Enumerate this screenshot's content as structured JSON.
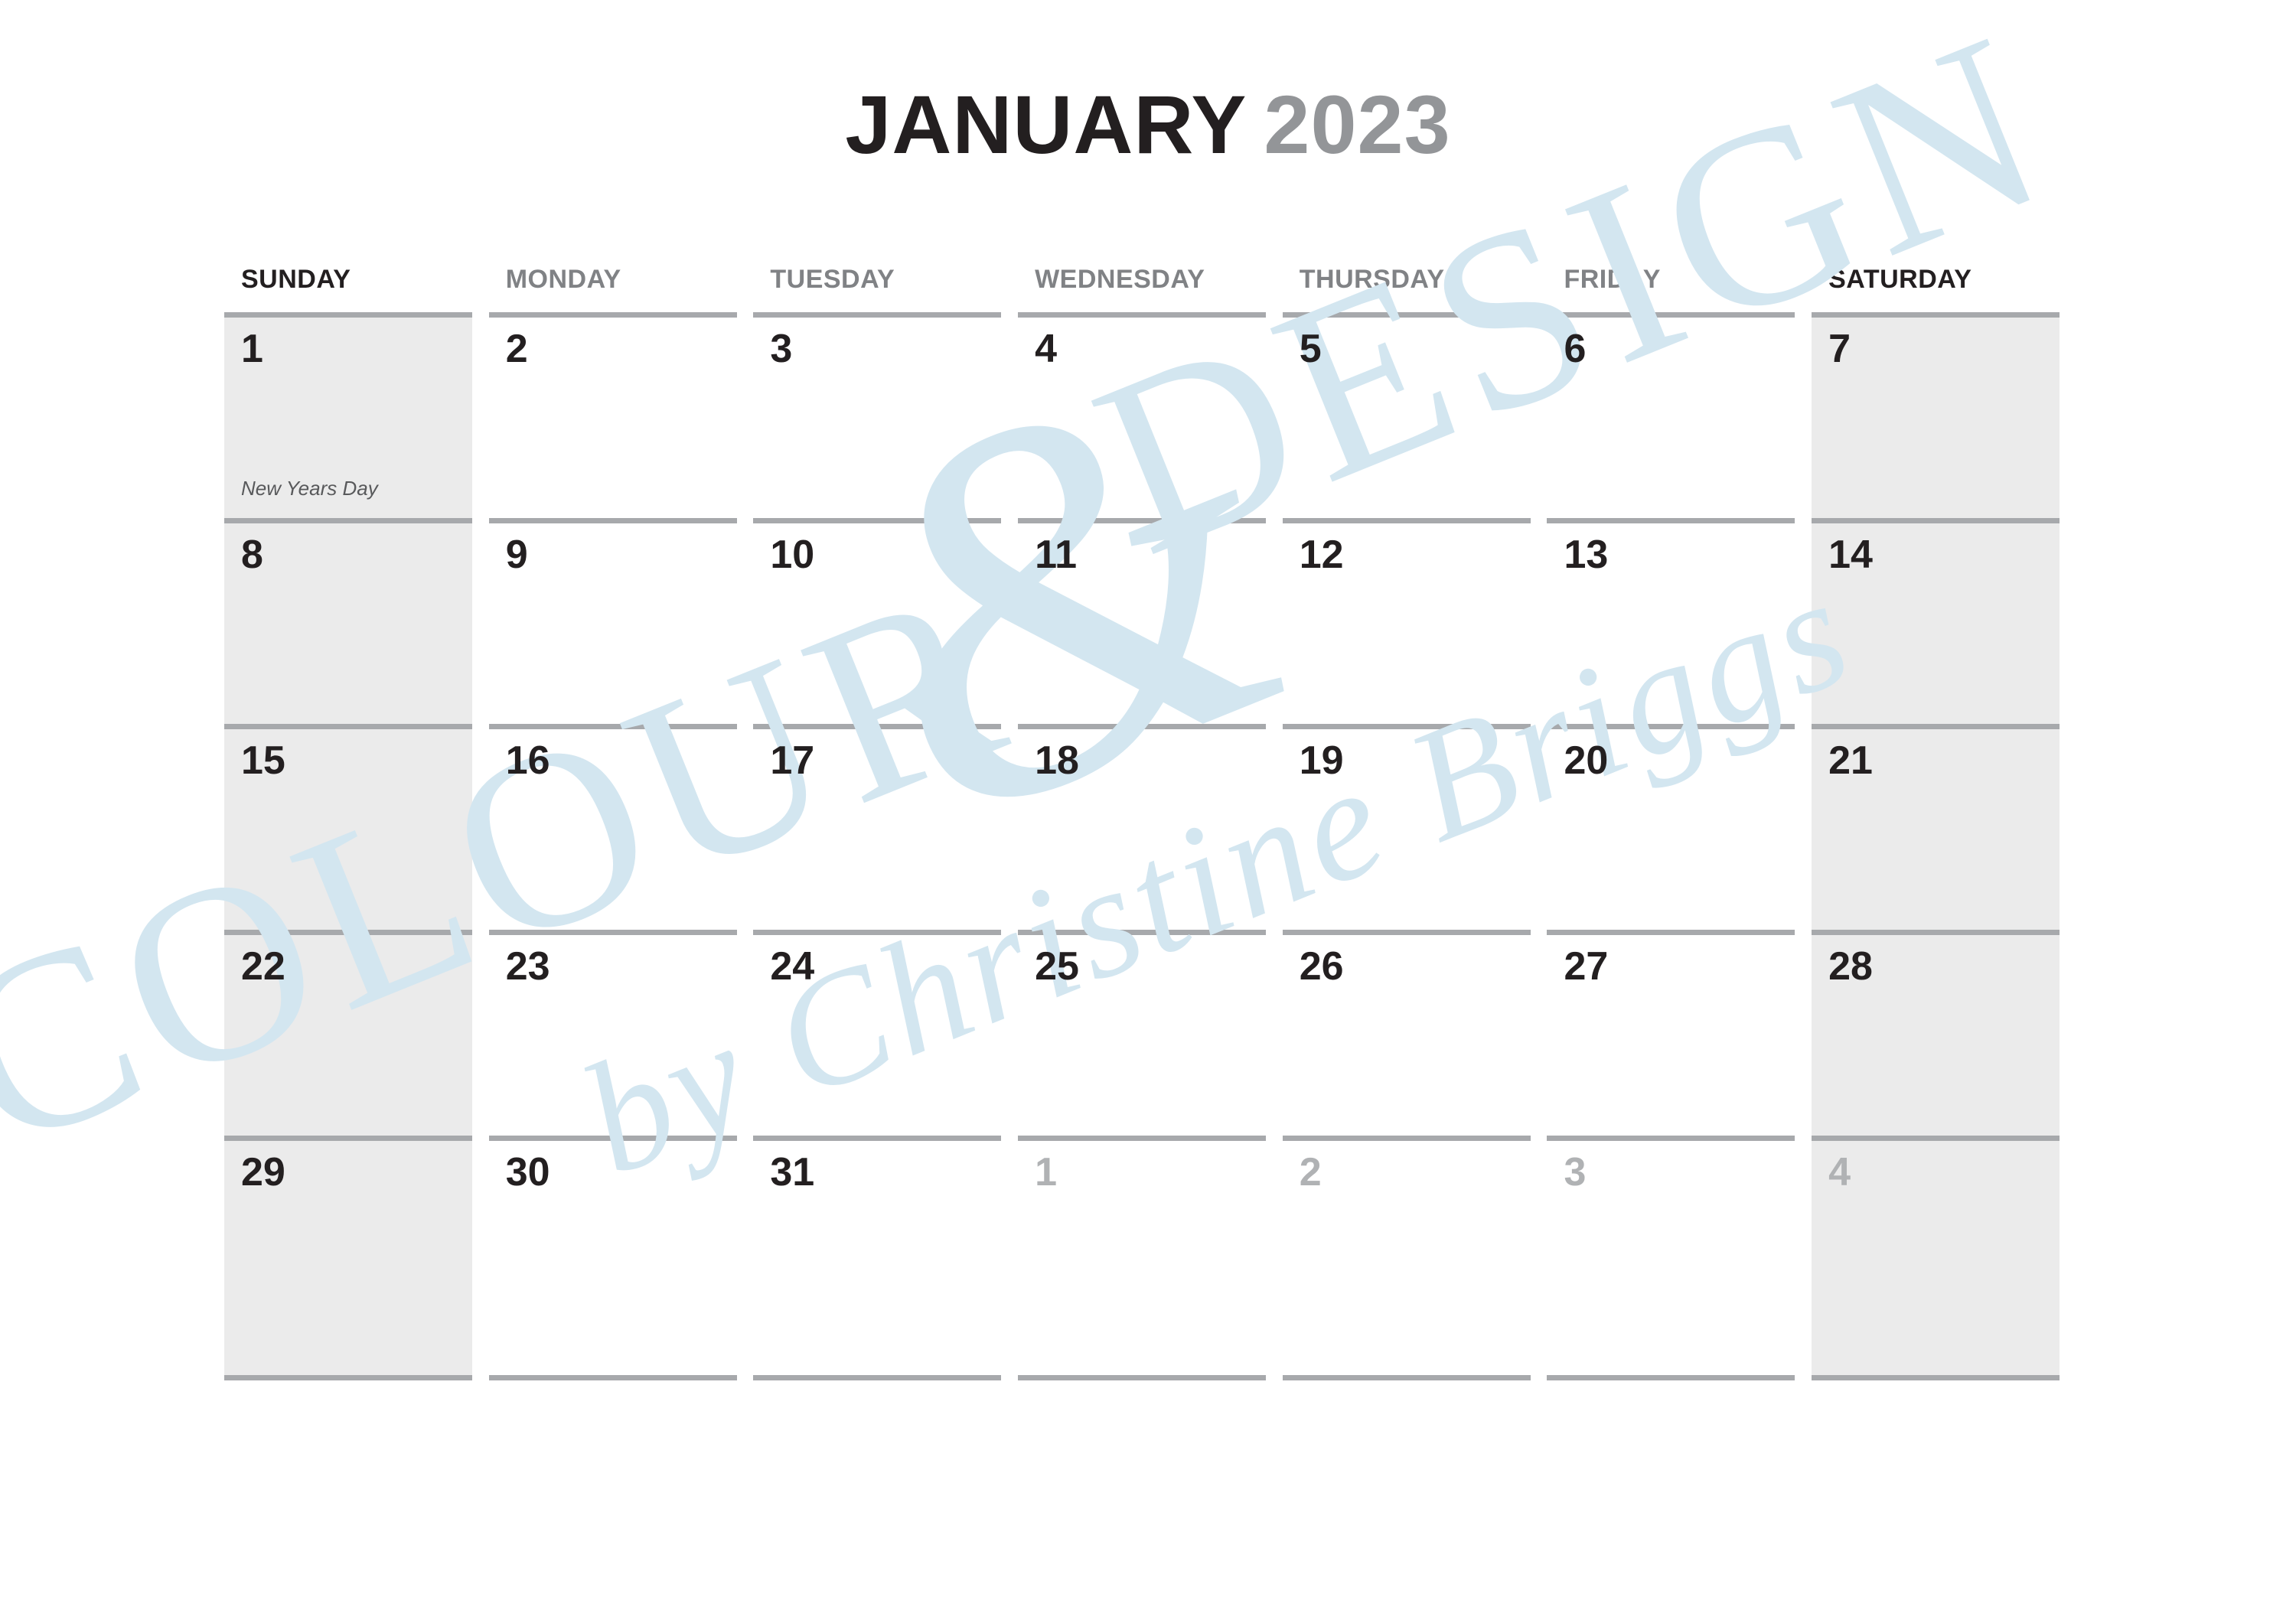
{
  "title": {
    "month": "JANUARY",
    "year": "2023",
    "month_color": "#231f20",
    "year_color": "#939598"
  },
  "weekdays": [
    {
      "label": "SUNDAY",
      "weekend": true
    },
    {
      "label": "MONDAY",
      "weekend": false
    },
    {
      "label": "TUESDAY",
      "weekend": false
    },
    {
      "label": "WEDNESDAY",
      "weekend": false
    },
    {
      "label": "THURSDAY",
      "weekend": false
    },
    {
      "label": "FRIDAY",
      "weekend": false
    },
    {
      "label": "SATURDAY",
      "weekend": true
    }
  ],
  "colors": {
    "rule": "#a7a9ac",
    "weekend_shade": "#ebebeb",
    "day_number": "#231f20",
    "other_month_number": "#b0b2b4",
    "weekday_label": "#808285",
    "weekend_label": "#231f20",
    "event_text": "#58595b",
    "watermark": "#d3e6f0"
  },
  "weeks": [
    [
      {
        "num": "1",
        "event": "New Years Day",
        "other": false,
        "shaded": true
      },
      {
        "num": "2",
        "event": "",
        "other": false,
        "shaded": false
      },
      {
        "num": "3",
        "event": "",
        "other": false,
        "shaded": false
      },
      {
        "num": "4",
        "event": "",
        "other": false,
        "shaded": false
      },
      {
        "num": "5",
        "event": "",
        "other": false,
        "shaded": false
      },
      {
        "num": "6",
        "event": "",
        "other": false,
        "shaded": false
      },
      {
        "num": "7",
        "event": "",
        "other": false,
        "shaded": true
      }
    ],
    [
      {
        "num": "8",
        "event": "",
        "other": false,
        "shaded": true
      },
      {
        "num": "9",
        "event": "",
        "other": false,
        "shaded": false
      },
      {
        "num": "10",
        "event": "",
        "other": false,
        "shaded": false
      },
      {
        "num": "11",
        "event": "",
        "other": false,
        "shaded": false
      },
      {
        "num": "12",
        "event": "",
        "other": false,
        "shaded": false
      },
      {
        "num": "13",
        "event": "",
        "other": false,
        "shaded": false
      },
      {
        "num": "14",
        "event": "",
        "other": false,
        "shaded": true
      }
    ],
    [
      {
        "num": "15",
        "event": "",
        "other": false,
        "shaded": true
      },
      {
        "num": "16",
        "event": "",
        "other": false,
        "shaded": false
      },
      {
        "num": "17",
        "event": "",
        "other": false,
        "shaded": false
      },
      {
        "num": "18",
        "event": "",
        "other": false,
        "shaded": false
      },
      {
        "num": "19",
        "event": "",
        "other": false,
        "shaded": false
      },
      {
        "num": "20",
        "event": "",
        "other": false,
        "shaded": false
      },
      {
        "num": "21",
        "event": "",
        "other": false,
        "shaded": true
      }
    ],
    [
      {
        "num": "22",
        "event": "",
        "other": false,
        "shaded": true
      },
      {
        "num": "23",
        "event": "",
        "other": false,
        "shaded": false
      },
      {
        "num": "24",
        "event": "",
        "other": false,
        "shaded": false
      },
      {
        "num": "25",
        "event": "",
        "other": false,
        "shaded": false
      },
      {
        "num": "26",
        "event": "",
        "other": false,
        "shaded": false
      },
      {
        "num": "27",
        "event": "",
        "other": false,
        "shaded": false
      },
      {
        "num": "28",
        "event": "",
        "other": false,
        "shaded": true
      }
    ],
    [
      {
        "num": "29",
        "event": "",
        "other": false,
        "shaded": true
      },
      {
        "num": "30",
        "event": "",
        "other": false,
        "shaded": false
      },
      {
        "num": "31",
        "event": "",
        "other": false,
        "shaded": false
      },
      {
        "num": "1",
        "event": "",
        "other": true,
        "shaded": false
      },
      {
        "num": "2",
        "event": "",
        "other": true,
        "shaded": false
      },
      {
        "num": "3",
        "event": "",
        "other": true,
        "shaded": false
      },
      {
        "num": "4",
        "event": "",
        "other": true,
        "shaded": true
      }
    ]
  ],
  "watermark": {
    "line1": "COLOUR",
    "symbol": "&",
    "line2": "DESIGN",
    "line3": "by Christine Briggs"
  }
}
